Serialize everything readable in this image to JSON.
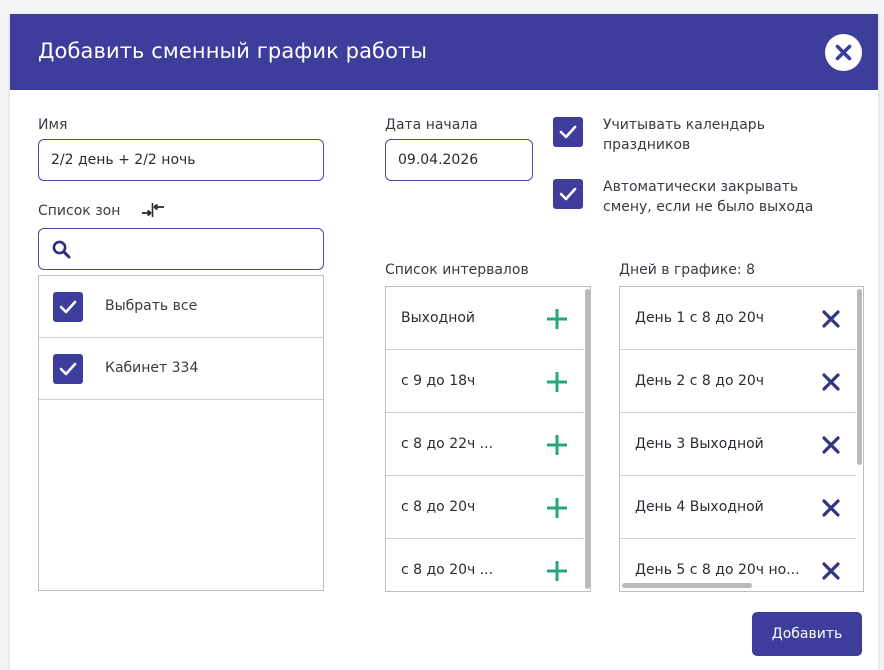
{
  "dialog": {
    "title": "Добавить сменный график работы",
    "close_icon": "close-icon"
  },
  "name_field": {
    "label": "Имя",
    "value": "2/2 день + 2/2 ночь"
  },
  "start_date": {
    "label": "Дата начала",
    "value": "09.04.2026"
  },
  "options": [
    {
      "label_line1": "Учитывать календарь",
      "label_line2": "праздников",
      "checked": true
    },
    {
      "label_line1": "Автоматически закрывать",
      "label_line2": "смену, если не было выхода",
      "checked": true
    }
  ],
  "zones": {
    "label": "Список зон",
    "toggle_icon": "swap-arrows-icon",
    "search_icon": "search-icon",
    "search_value": "",
    "items": [
      {
        "label": "Выбрать все",
        "checked": true
      },
      {
        "label": "Кабинет 334",
        "checked": true
      }
    ]
  },
  "intervals": {
    "label": "Список интервалов",
    "add_icon": "plus-icon",
    "items": [
      {
        "label": "Выходной"
      },
      {
        "label": "с 9 до 18ч"
      },
      {
        "label": "с 8 до 22ч ..."
      },
      {
        "label": "с 8 до 20ч"
      },
      {
        "label": "с 8 до 20ч ..."
      }
    ]
  },
  "schedule_days": {
    "label": "Дней в графике: 8",
    "remove_icon": "remove-x-icon",
    "items": [
      {
        "label": "День 1 с 8 до 20ч"
      },
      {
        "label": "День 2 с 8 до 20ч"
      },
      {
        "label": "День 3 Выходной"
      },
      {
        "label": "День 4 Выходной"
      },
      {
        "label": "День 5 с 8 до 20ч но..."
      }
    ]
  },
  "footer": {
    "add_button": "Добавить"
  },
  "colors": {
    "primary": "#3d3d9c",
    "add_green": "#27a67a",
    "remove_navy": "#33337f"
  }
}
